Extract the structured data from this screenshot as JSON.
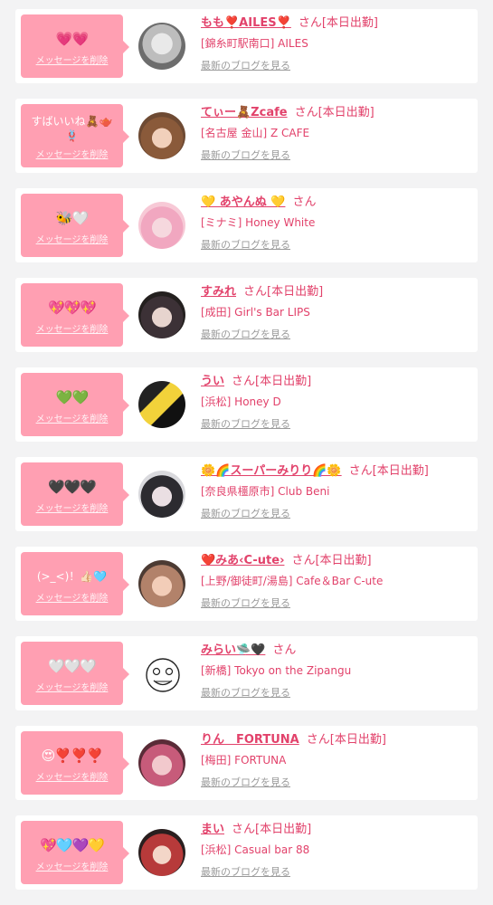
{
  "delete_label": "メッセージを削除",
  "blog_label": "最新のブログを見る",
  "san_label": "さん",
  "items": [
    {
      "stamp": "💗💗",
      "name": "もも❣️AILES❣️",
      "tag": "[本日出勤]",
      "shop": "[錦糸町駅南口] AILES",
      "avatar_icon": "bunny-avatar-icon"
    },
    {
      "stamp": "すばいいね🧸🫖🪢",
      "name": "てぃー🧸Zcafe",
      "tag": "[本日出勤]",
      "shop": "[名古屋 金山] Z CAFE",
      "avatar_icon": "girl-avatar-icon"
    },
    {
      "stamp": "🐝🤍",
      "name": "💛 あやんぬ 💛",
      "tag": "",
      "shop": "[ミナミ] Honey White",
      "avatar_icon": "girl-avatar-icon"
    },
    {
      "stamp": "💖💖💖",
      "name": "すみれ",
      "tag": "[本日出勤]",
      "shop": "[成田] Girl's Bar LIPS",
      "avatar_icon": "girl-avatar-icon"
    },
    {
      "stamp": "💚💚",
      "name": "うい",
      "tag": "[本日出勤]",
      "shop": "[浜松] Honey D",
      "avatar_icon": "shop-logo-avatar-icon"
    },
    {
      "stamp": "🖤🖤🖤",
      "name": "🌼🌈スーパーみりり🌈🌼",
      "tag": "[本日出勤]",
      "shop": "[奈良県橿原市] Club Beni",
      "avatar_icon": "girl-avatar-icon"
    },
    {
      "stamp": "(>_<)！👍🏻🩵",
      "name": "❤️みあ‹C-ute›",
      "tag": "[本日出勤]",
      "shop": "[上野/御徒町/湯島] Cafe＆Bar C-ute",
      "avatar_icon": "girl-avatar-icon"
    },
    {
      "stamp": "🤍🤍🤍",
      "name": "みらい🛸🖤",
      "tag": "",
      "shop": "[新橋] Tokyo on the Zipangu",
      "avatar_icon": "doodle-face-avatar-icon"
    },
    {
      "stamp": "😍❣️❣️❣️",
      "name": "りん　FORTUNA",
      "tag": "[本日出勤]",
      "shop": "[梅田] FORTUNA",
      "avatar_icon": "girl-avatar-icon"
    },
    {
      "stamp": "💖🩵💜💛",
      "name": "まい",
      "tag": "[本日出勤]",
      "shop": "[浜松] Casual bar 88",
      "avatar_icon": "girl-avatar-icon"
    }
  ]
}
